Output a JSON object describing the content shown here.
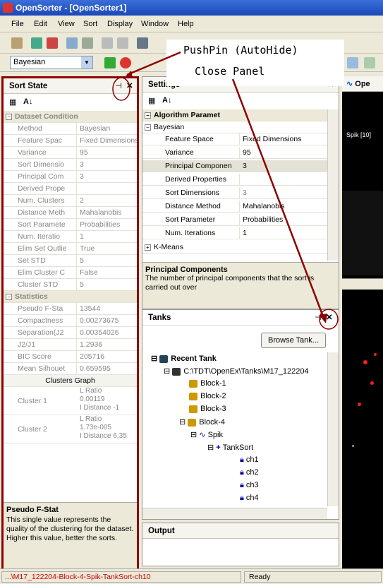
{
  "window": {
    "title": "OpenSorter - [OpenSorter1]"
  },
  "menu": [
    "File",
    "Edit",
    "View",
    "Sort",
    "Display",
    "Window",
    "Help"
  ],
  "toolbar": {
    "method_value": "Bayesian"
  },
  "annotations": {
    "pushpin": "PushPin (AutoHide)",
    "close": "Close Panel"
  },
  "sort_state": {
    "title": "Sort State",
    "dataset_header": "Dataset Condition",
    "dataset_rows": [
      {
        "name": "Method",
        "value": "Bayesian"
      },
      {
        "name": "Feature Spac",
        "value": "Fixed Dimensions"
      },
      {
        "name": "Variance",
        "value": "95"
      },
      {
        "name": "Sort Dimensio",
        "value": "3"
      },
      {
        "name": "Principal Com",
        "value": "3"
      },
      {
        "name": "Derived Prope",
        "value": ""
      },
      {
        "name": "Num. Clusters",
        "value": "2"
      },
      {
        "name": "Distance Meth",
        "value": "Mahalanobis"
      },
      {
        "name": "Sort Paramete",
        "value": "Probabilities"
      },
      {
        "name": "Num. Iteratio",
        "value": "1"
      },
      {
        "name": "Elim Set Outlie",
        "value": "True"
      },
      {
        "name": "Set STD",
        "value": "5"
      },
      {
        "name": "Elim Cluster C",
        "value": "False"
      },
      {
        "name": "Cluster STD",
        "value": "5"
      }
    ],
    "stats_header": "Statistics",
    "stats_rows": [
      {
        "name": "Pseudo F-Sta",
        "value": "13544"
      },
      {
        "name": "Compactness",
        "value": "0.00273675"
      },
      {
        "name": "Separation(J2",
        "value": "0.00354026"
      },
      {
        "name": "J2/J1",
        "value": "1.2936"
      },
      {
        "name": "BIC Score",
        "value": "205716"
      },
      {
        "name": "Mean Silhouet",
        "value": "0.659595"
      }
    ],
    "clusters_graph": "Clusters Graph",
    "clusters": [
      {
        "name": "Cluster 1",
        "lines": [
          "L Ratio",
          "0.00119",
          "I Distance  -1"
        ]
      },
      {
        "name": "Cluster 2",
        "lines": [
          "L Ratio",
          "1.73e-005",
          "I Distance  6.35"
        ]
      }
    ],
    "desc_title": "Pseudo F-Stat",
    "desc_text": "This single value represents the quality of the clustering for the dataset. Higher this value, better the sorts."
  },
  "settings": {
    "title": "Settings",
    "algo_header": "Algorithm Paramet",
    "bayes_header": "Bayesian",
    "rows": [
      {
        "name": "Feature Space",
        "value": "Fixed Dimensions"
      },
      {
        "name": "Variance",
        "value": "95"
      },
      {
        "name": "Principal Componen",
        "value": "3"
      },
      {
        "name": "Derived Properties",
        "value": ""
      },
      {
        "name": "Sort Dimensions",
        "value": "3"
      },
      {
        "name": "Distance Method",
        "value": "Mahalanobis"
      },
      {
        "name": "Sort Parameter",
        "value": "Probabilities"
      },
      {
        "name": "Num. Iterations",
        "value": "1"
      }
    ],
    "kmeans_header": "K-Means",
    "desc_title": "Principal Components",
    "desc_text": "The number of principal components that the sort is carried out over"
  },
  "tanks": {
    "title": "Tanks",
    "browse_label": "Browse Tank...",
    "recent": "Recent Tank",
    "path": "C:\\TDT\\OpenEx\\Tanks\\M17_122204",
    "blocks": [
      "Block-1",
      "Block-2",
      "Block-3",
      "Block-4"
    ],
    "spik": "Spik",
    "tanksort": "TankSort",
    "channels": [
      "ch1",
      "ch2",
      "ch3",
      "ch4"
    ]
  },
  "output": {
    "title": "Output"
  },
  "right": {
    "tab": "Ope",
    "label": "Spik [10]"
  },
  "status": {
    "path": "...\\M17_122204-Block-4-Spik-TankSort-ch10",
    "state": "Ready"
  }
}
